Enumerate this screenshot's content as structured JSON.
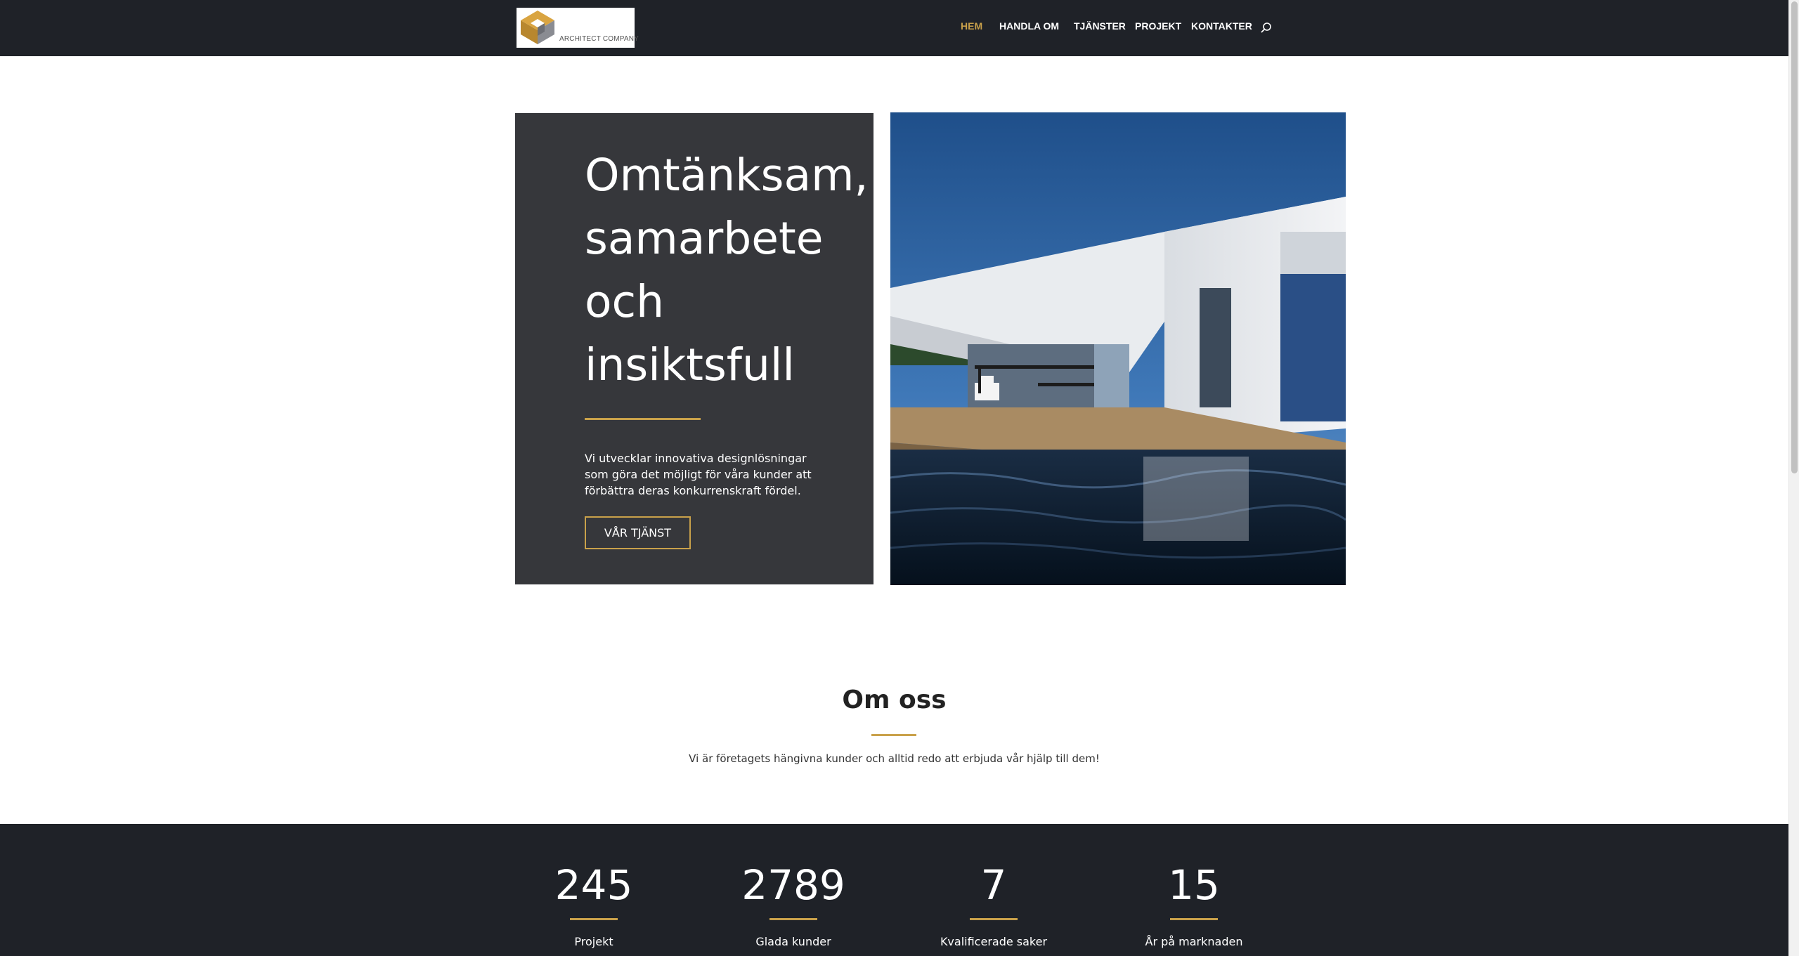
{
  "header": {
    "logo_text": "ARCHITECT COMPANY",
    "nav": [
      {
        "label": "HEM",
        "active": true
      },
      {
        "label": "HANDLA OM",
        "active": false
      },
      {
        "label": "TJÄNSTER",
        "active": false
      },
      {
        "label": "PROJEKT",
        "active": false
      },
      {
        "label": "KONTAKTER",
        "active": false
      }
    ],
    "search_icon": "search-icon"
  },
  "hero": {
    "title_lines": [
      "Omtänksam,",
      "samarbete",
      "och",
      "insiktsfull"
    ],
    "text": "Vi utvecklar innovativa designlösningar som göra det möjligt för våra kunder att förbättra deras konkurrenskraft fördel.",
    "button_label": "VÅR TJÄNST"
  },
  "about": {
    "title": "Om oss",
    "text": "Vi är företagets hängivna kunder och alltid redo att erbjuda vår hjälp till dem!"
  },
  "stats": [
    {
      "number": "245",
      "label": "Projekt"
    },
    {
      "number": "2789",
      "label": "Glada kunder"
    },
    {
      "number": "7",
      "label": "Kvalificerade saker"
    },
    {
      "number": "15",
      "label": "År på marknaden"
    }
  ],
  "colors": {
    "accent": "#c9a14a",
    "dark": "#1f2228",
    "card": "#36373b"
  }
}
